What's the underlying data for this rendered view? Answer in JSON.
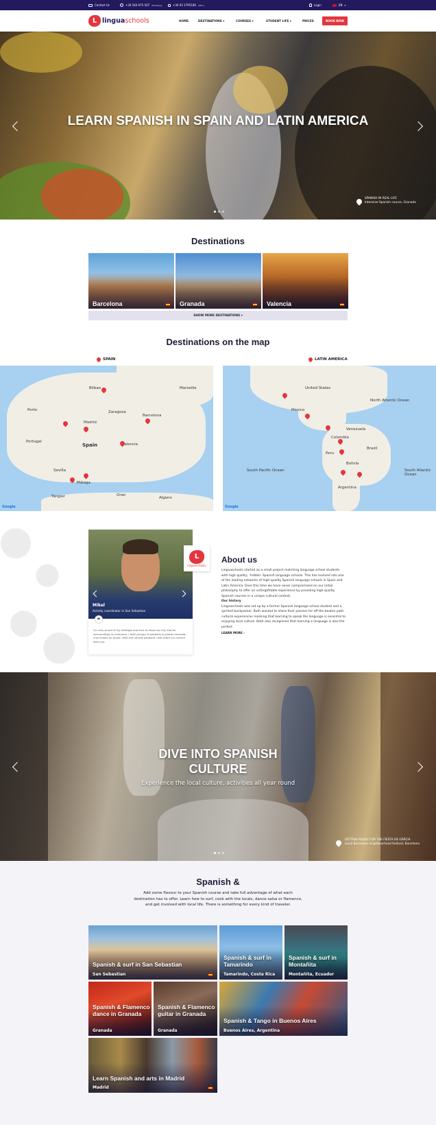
{
  "topbar": {
    "contact": "Contact Us",
    "phone1": "+34 544 675 507",
    "phone1_note": "WhatsApp",
    "phone2": "+34 93 1795106",
    "phone2_note": "Office",
    "login": "Login",
    "language": "EN"
  },
  "header": {
    "logo_part1": "lingua",
    "logo_part2": "schools",
    "nav": [
      "HOME",
      "DESTINATIONS",
      "COURSES",
      "STUDENT LIFE",
      "PRICES"
    ],
    "book_label": "BOOK NOW"
  },
  "hero": {
    "title": "LEARN SPANISH IN SPAIN AND LATIN AMERICA",
    "caption_line1": "SPANISH IN REAL LIFE",
    "caption_line2": "Intensive Spanish course, Granada"
  },
  "destinations": {
    "heading": "Destinations",
    "cards": [
      {
        "name": "Barcelona"
      },
      {
        "name": "Granada"
      },
      {
        "name": "Valencia"
      }
    ],
    "show_more": "SHOW MORE DESTINATIONS"
  },
  "maps": {
    "heading": "Destinations on the map",
    "spain_label": "SPAIN",
    "latam_label": "LATIN AMERICA",
    "spain_places": [
      "Portugal",
      "Spain",
      "Madrid",
      "Barcelona",
      "Valencia",
      "Zaragoza",
      "Bilbao",
      "Marseille",
      "Porto",
      "Sevilla",
      "Málaga",
      "Tangier",
      "Oran",
      "Algiers"
    ],
    "latam_places": [
      "United States",
      "Mexico",
      "Brazil",
      "North Atlantic Ocean",
      "South Pacific Ocean",
      "South Atlantic Ocean",
      "Bolivia",
      "Peru",
      "Argentina",
      "Venezuela",
      "Colombia"
    ],
    "google": "Google"
  },
  "about": {
    "heading": "About us",
    "person_name": "Mikel",
    "person_role": "Activity coordinator in San Sebastian",
    "quote": "I'm very proud of my heritage and love to show our city and its surroundings to everyone. I take groups of students to places normally only known by locals. With the utmost pleasure I will share our culture with you.",
    "badge_text": "linguaschools",
    "paragraph1": "Linguaschools started as a small project matching language school students with high quality, 'hidden' Spanish language schools. This has evolved into one of the leading networks of high-quality Spanish language schools in Spain and Latin America. Over this time we have never compromised on our initial philosophy to offer an unforgettable experience by providing high-quality Spanish courses in a unique cultural context.",
    "subheading": "Our history",
    "paragraph2": "Linguaschools was set up by a former Spanish language school student and a spirited backpacker. Both wanted to share their passion for off the beaten path cultural experiences realising that learning to speak the language is essential to enjoying local culture. Both also recognised that learning a language is also the perfect",
    "learn_more": "LEARN MORE"
  },
  "culture": {
    "title": "DIVE INTO SPANISH CULTURE",
    "subtitle": "Experience the local culture, activities all year round",
    "caption_line1": "GETTING READY FOR THE FIESTA DE GRÀCIA",
    "caption_line2": "Local Barcelona neighbourhood festival, Barcelona"
  },
  "spanish_and": {
    "heading": "Spanish &",
    "intro": "Add some flavour to your Spanish course and take full advantage of what each destination has to offer. Learn how to surf, cook with the locals, dance salsa or flamenco, and get involved with local life. There is something for every kind of traveler.",
    "tiles": [
      {
        "title": "Spanish & surf in San Sebastian",
        "location": "San Sebastian"
      },
      {
        "title": "Spanish & surf in Tamarindo",
        "location": "Tamarindo, Costa Rica"
      },
      {
        "title": "Spanish & surf in Montañita",
        "location": "Montañita, Ecuador"
      },
      {
        "title": "Spanish & Flamenco dance in Granada",
        "location": "Granada"
      },
      {
        "title": "Spanish & Flamenco guitar in Granada",
        "location": "Granada"
      },
      {
        "title": "Spanish & Tango in Buenos Aires",
        "location": "Buenos Aires, Argentina"
      },
      {
        "title": "Learn Spanish and arts in Madrid",
        "location": "Madrid"
      }
    ]
  },
  "colors": {
    "brand_red": "#e4353d",
    "navy": "#22195e"
  },
  "icons": [
    "envelope-icon",
    "whatsapp-icon",
    "phone-icon",
    "user-icon",
    "flag-icon",
    "chevron-down-icon",
    "chevron-left-icon",
    "chevron-right-icon",
    "map-pin-icon",
    "quote-icon"
  ]
}
